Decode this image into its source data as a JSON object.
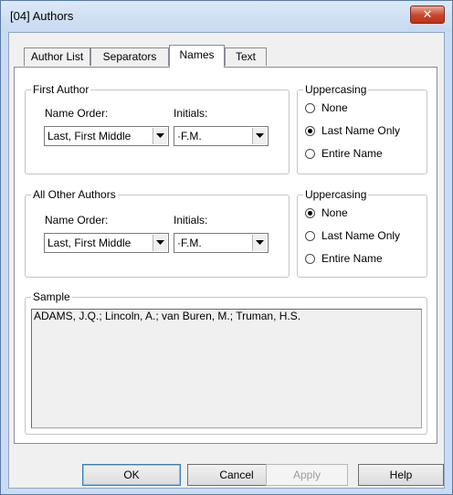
{
  "window": {
    "title": "[04] Authors",
    "close_label": "✕"
  },
  "tabs": [
    {
      "label": "Author List",
      "active": false
    },
    {
      "label": "Separators",
      "active": false
    },
    {
      "label": "Names",
      "active": true
    },
    {
      "label": "Text",
      "active": false
    }
  ],
  "first_author": {
    "group_label": "First Author",
    "name_order_label": "Name Order:",
    "name_order_value": "Last, First Middle",
    "initials_label": "Initials:",
    "initials_value": "·F.M."
  },
  "first_uppercasing": {
    "group_label": "Uppercasing",
    "options": [
      {
        "label": "None",
        "checked": false
      },
      {
        "label": "Last Name Only",
        "checked": true
      },
      {
        "label": "Entire Name",
        "checked": false
      }
    ]
  },
  "other_authors": {
    "group_label": "All Other Authors",
    "name_order_label": "Name Order:",
    "name_order_value": "Last, First Middle",
    "initials_label": "Initials:",
    "initials_value": "·F.M."
  },
  "other_uppercasing": {
    "group_label": "Uppercasing",
    "options": [
      {
        "label": "None",
        "checked": true
      },
      {
        "label": "Last Name Only",
        "checked": false
      },
      {
        "label": "Entire Name",
        "checked": false
      }
    ]
  },
  "sample": {
    "group_label": "Sample",
    "text": "ADAMS, J.Q.; Lincoln, A.; van Buren, M.; Truman, H.S."
  },
  "buttons": {
    "ok": "OK",
    "cancel": "Cancel",
    "apply": "Apply",
    "help": "Help"
  }
}
